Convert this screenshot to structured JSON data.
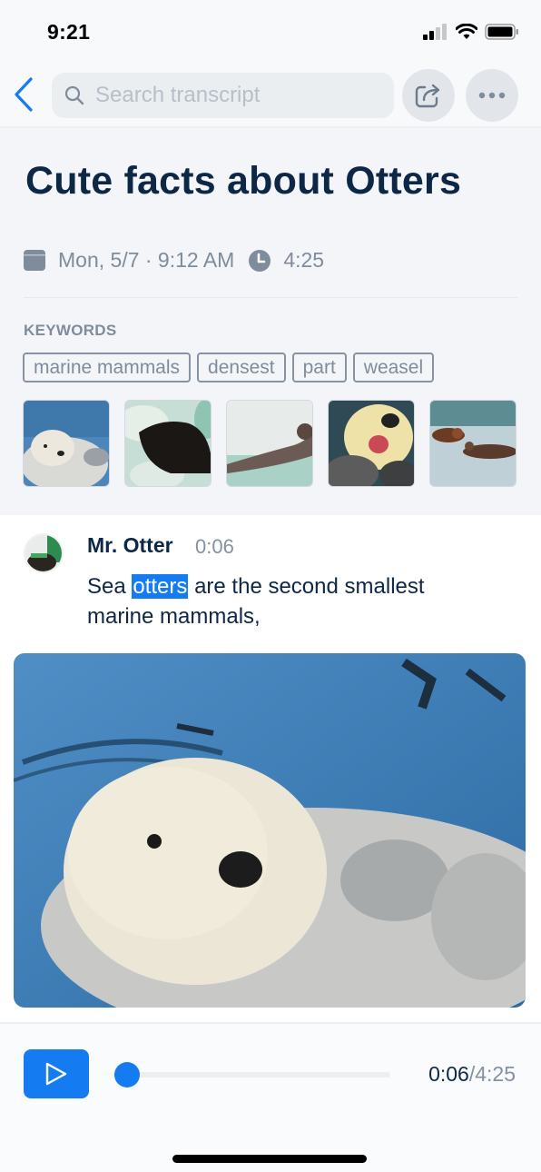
{
  "status_bar": {
    "time": "9:21",
    "icons": [
      "cellular-signal-icon",
      "wifi-icon",
      "battery-icon"
    ]
  },
  "nav": {
    "back_icon": "chevron-left-icon",
    "search": {
      "placeholder": "Search transcript",
      "value": "",
      "icon": "search-icon"
    },
    "share_icon": "share-icon",
    "more_icon": "more-horizontal-icon"
  },
  "note": {
    "title": "Cute facts about Otters",
    "date": "Mon, 5/7 · 9:12 AM",
    "duration": "4:25",
    "keywords_label": "KEYWORDS",
    "keywords": [
      "marine mammals",
      "densest",
      "part",
      "weasel"
    ],
    "thumbnails": [
      {
        "desc": "white sea otter floating in blue water"
      },
      {
        "desc": "dark otter on pale green rocks"
      },
      {
        "desc": "otter floating on back in water"
      },
      {
        "desc": "yawning pale sea otter"
      },
      {
        "desc": "two otters swimming in water"
      }
    ]
  },
  "transcript": {
    "speaker": "Mr. Otter",
    "timestamp": "0:06",
    "text_before": "Sea ",
    "text_highlight": "otters",
    "text_after": " are the second smallest marine mammals,",
    "image_desc": "close-up of a white-faced sea otter floating in blue water"
  },
  "player": {
    "current": "0:06",
    "separator": "/",
    "total": "4:25",
    "progress_fraction": 0.0226,
    "accent": "#147cf0"
  }
}
